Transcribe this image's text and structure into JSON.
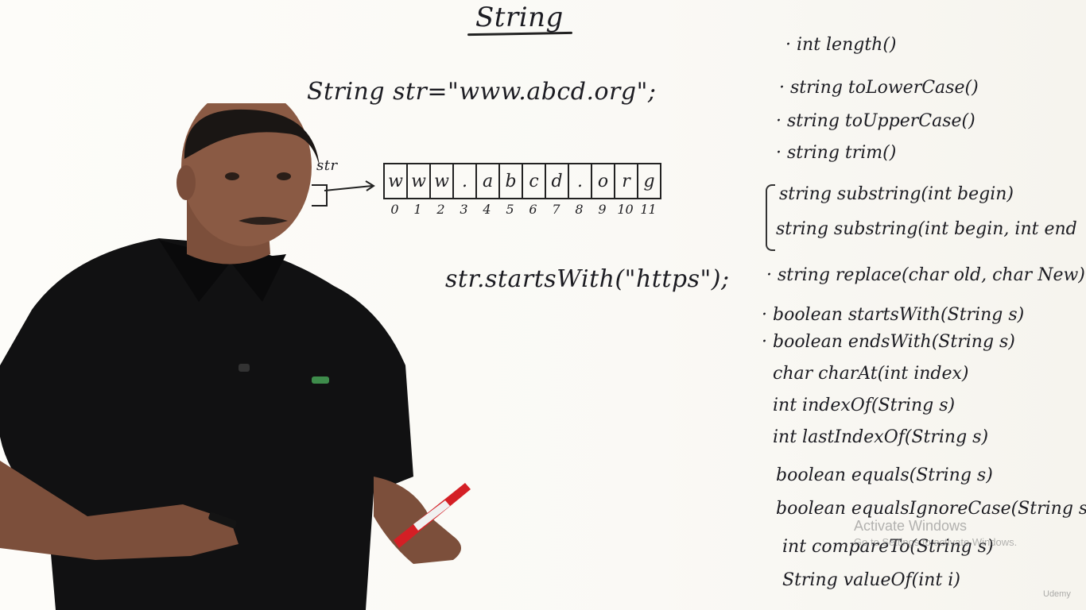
{
  "board": {
    "title": "String",
    "declaration": "String str=\"www.abcd.org\";",
    "pointer_label": "str",
    "array_chars": [
      "w",
      "w",
      "w",
      ".",
      "a",
      "b",
      "c",
      "d",
      ".",
      "o",
      "r",
      "g"
    ],
    "array_indices": [
      "0",
      "1",
      "2",
      "3",
      "4",
      "5",
      "6",
      "7",
      "8",
      "9",
      "10",
      "11"
    ],
    "method_call": "str.startsWith(\"https\");"
  },
  "methods": [
    "· int  length()",
    "· string  toLowerCase()",
    "· string  toUpperCase()",
    "· string  trim()",
    "string  substring(int begin)",
    "string  substring(int begin, int end",
    "· string  replace(char old, char New)",
    "· boolean  startsWith(String s)",
    "· boolean  endsWith(String s)",
    "char   charAt(int index)",
    "int   indexOf(String s)",
    "int   lastIndexOf(String s)",
    "boolean  equals(String s)",
    "boolean  equalsIgnoreCase(String s)",
    "int  compareTo(String s)",
    "String  valueOf(int i)"
  ],
  "watermark": {
    "title": "Activate Windows",
    "subtitle": "Go to Settings to activate Windows."
  },
  "logo_text": "Udemy",
  "colors": {
    "board": "#fbfaf7",
    "ink": "#1c1c22",
    "shirt": "#111112",
    "skin": "#8a5a44",
    "marker_red": "#d41f25"
  }
}
